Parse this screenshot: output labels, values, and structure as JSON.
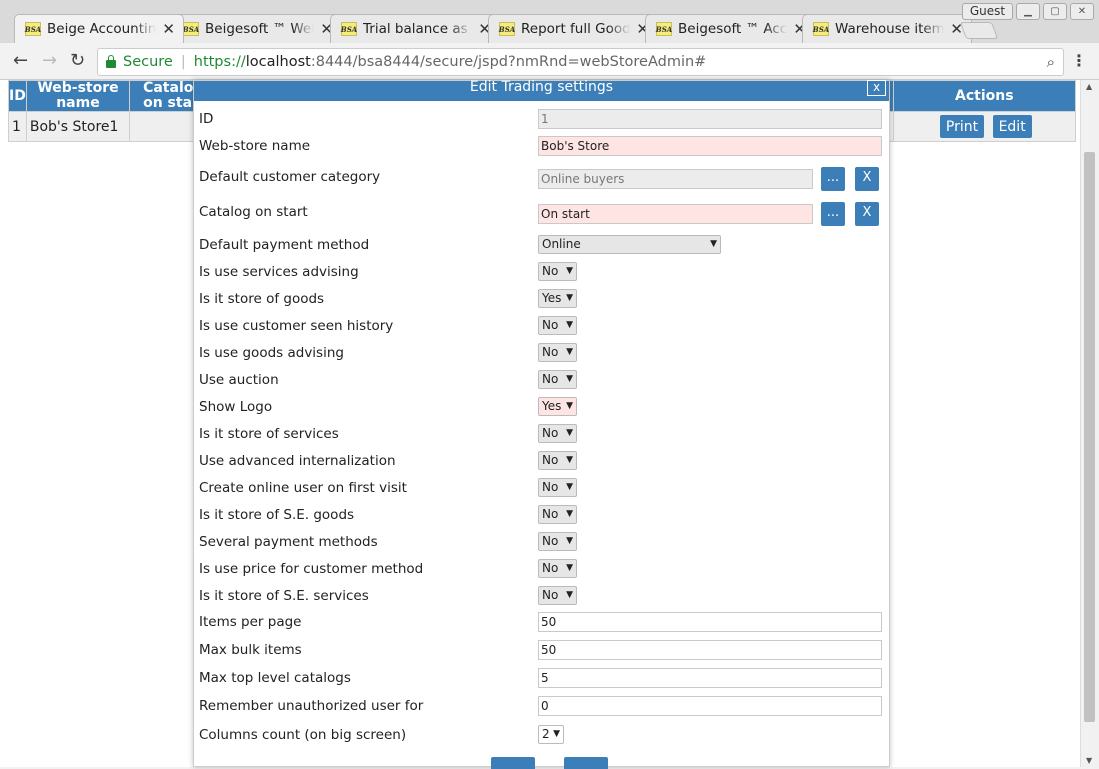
{
  "browser": {
    "tabs": [
      {
        "title": "Beige Accounting",
        "favicon": "BSA"
      },
      {
        "title": "Beigesoft ™ Web",
        "favicon": "BSA"
      },
      {
        "title": "Trial balance as of",
        "favicon": "BSA"
      },
      {
        "title": "Report full Goods",
        "favicon": "BSA"
      },
      {
        "title": "Beigesoft ™ Acc",
        "favicon": "BSA"
      },
      {
        "title": "Warehouse items",
        "favicon": "BSA"
      }
    ],
    "guest_label": "Guest",
    "secure_label": "Secure",
    "url_protocol": "https://",
    "url_host": "localhost",
    "url_path": ":8444/bsa8444/secure/jspd?nmRnd=webStoreAdmin#"
  },
  "grid": {
    "headers": {
      "id": "ID",
      "name": "Web-store name",
      "catalog": "Catalog on start",
      "actions": "Actions"
    },
    "rows": [
      {
        "id": "1",
        "name": "Bob's Store1",
        "print": "Print",
        "edit": "Edit"
      }
    ]
  },
  "dialog": {
    "title": "Edit Trading settings",
    "close": "x",
    "fields": {
      "id": {
        "label": "ID",
        "value": "1"
      },
      "web_store_name": {
        "label": "Web-store name",
        "value": "Bob's Store"
      },
      "default_customer_category": {
        "label": "Default customer category",
        "value": "Online buyers"
      },
      "catalog_on_start": {
        "label": "Catalog on start",
        "value": "On start"
      },
      "default_payment_method": {
        "label": "Default payment method",
        "value": "Online"
      },
      "use_services_advising": {
        "label": "Is use services advising",
        "value": "No"
      },
      "store_of_goods": {
        "label": "Is it store of goods",
        "value": "Yes"
      },
      "use_customer_seen_history": {
        "label": "Is use customer seen history",
        "value": "No"
      },
      "use_goods_advising": {
        "label": "Is use goods advising",
        "value": "No"
      },
      "use_auction": {
        "label": "Use auction",
        "value": "No"
      },
      "show_logo": {
        "label": "Show Logo",
        "value": "Yes"
      },
      "store_of_services": {
        "label": "Is it store of services",
        "value": "No"
      },
      "use_advanced_internalization": {
        "label": "Use advanced internalization",
        "value": "No"
      },
      "create_online_user": {
        "label": "Create online user on first visit",
        "value": "No"
      },
      "store_of_se_goods": {
        "label": "Is it store of S.E. goods",
        "value": "No"
      },
      "several_payment_methods": {
        "label": "Several payment methods",
        "value": "No"
      },
      "use_price_for_customer": {
        "label": "Is use price for customer method",
        "value": "No"
      },
      "store_of_se_services": {
        "label": "Is it store of S.E. services",
        "value": "No"
      },
      "items_per_page": {
        "label": "Items per page",
        "value": "50"
      },
      "max_bulk_items": {
        "label": "Max bulk items",
        "value": "50"
      },
      "max_top_level_catalogs": {
        "label": "Max top level catalogs",
        "value": "5"
      },
      "remember_unauthorized_user": {
        "label": "Remember unauthorized user for",
        "value": "0"
      },
      "columns_count": {
        "label": "Columns count (on big screen)",
        "value": "2"
      }
    },
    "pick_label": "...",
    "clear_label": "X"
  },
  "colors": {
    "accent": "#3c7fb8",
    "required_bg": "#ffe4e4",
    "readonly_bg": "#ececec"
  }
}
